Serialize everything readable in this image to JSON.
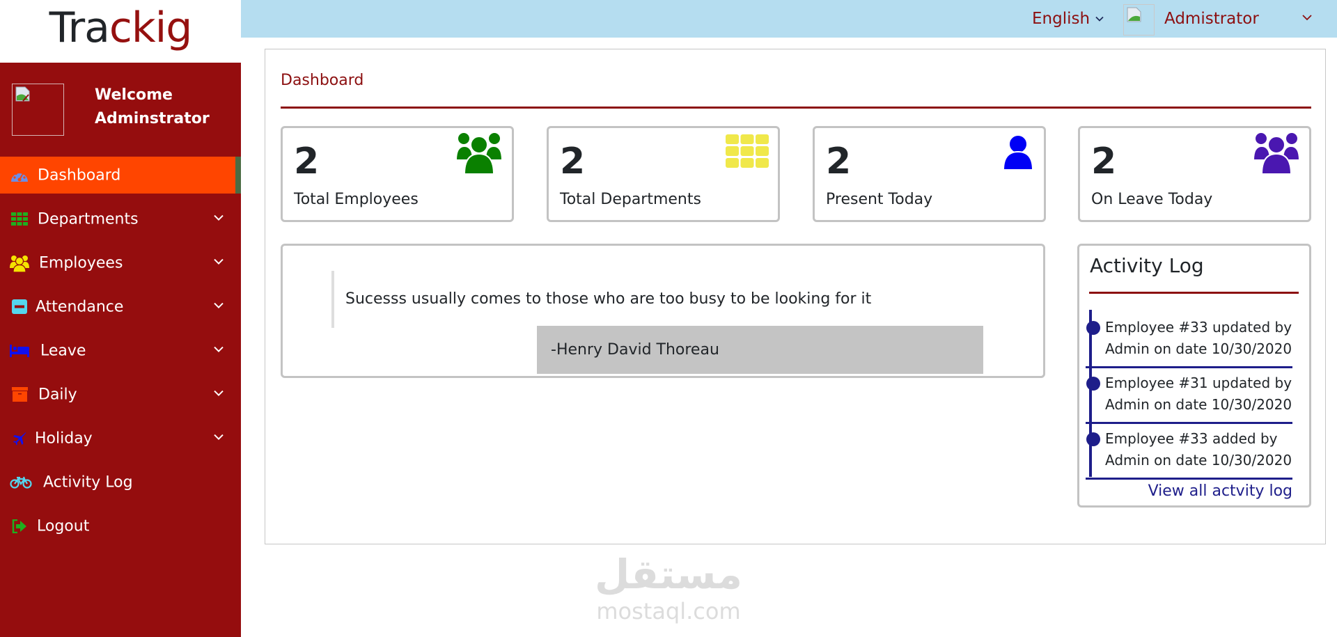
{
  "logo": {
    "part1": "Tra",
    "part2": "ckig"
  },
  "sidebar": {
    "welcome_line1": "Welcome",
    "welcome_line2": "Adminstrator",
    "items": [
      {
        "label": "Dashboard",
        "icon": "dashboard-gauge-icon",
        "active": true,
        "has_submenu": false
      },
      {
        "label": "Departments",
        "icon": "grid-icon",
        "active": false,
        "has_submenu": true
      },
      {
        "label": "Employees",
        "icon": "users-icon",
        "active": false,
        "has_submenu": true
      },
      {
        "label": "Attendance",
        "icon": "minus-square-icon",
        "active": false,
        "has_submenu": true
      },
      {
        "label": "Leave",
        "icon": "bed-icon",
        "active": false,
        "has_submenu": true
      },
      {
        "label": "Daily",
        "icon": "archive-box-icon",
        "active": false,
        "has_submenu": true
      },
      {
        "label": "Holiday",
        "icon": "plane-icon",
        "active": false,
        "has_submenu": true
      },
      {
        "label": "Activity Log",
        "icon": "bicycle-icon",
        "active": false,
        "has_submenu": false
      },
      {
        "label": "Logout",
        "icon": "sign-out-icon",
        "active": false,
        "has_submenu": false
      }
    ]
  },
  "header": {
    "language": "English",
    "user_name": "Admistrator"
  },
  "main": {
    "title": "Dashboard",
    "stats": [
      {
        "value": "2",
        "label": "Total Employees",
        "icon": "users-icon",
        "color": "#0a8000"
      },
      {
        "value": "2",
        "label": "Total Departments",
        "icon": "grid-icon",
        "color": "#f0e84a"
      },
      {
        "value": "2",
        "label": "Present Today",
        "icon": "user-icon",
        "color": "#0000f5"
      },
      {
        "value": "2",
        "label": "On Leave Today",
        "icon": "users-icon",
        "color": "#4a17b0"
      }
    ],
    "quote": {
      "text": "Sucesss usually comes to those who are too busy to be looking for it",
      "author": "-Henry David Thoreau"
    },
    "activity_log": {
      "title": "Activity Log",
      "items": [
        {
          "text": "Employee #33 updated by\nAdmin on date 10/30/2020"
        },
        {
          "text": "Employee #31 updated by\nAdmin on date 10/30/2020"
        },
        {
          "text": "Employee #33 added by\nAdmin on date 10/30/2020"
        }
      ],
      "view_all": "View all actvity log"
    }
  },
  "colors": {
    "sidebar_bg": "#950d0e",
    "active_item_bg": "#ff4500",
    "header_bg": "#b5ddf0",
    "accent": "#8c0f10",
    "timeline": "#1e1e8a"
  },
  "watermark": {
    "arabic": "مستقل",
    "latin": "mostaql.com"
  }
}
